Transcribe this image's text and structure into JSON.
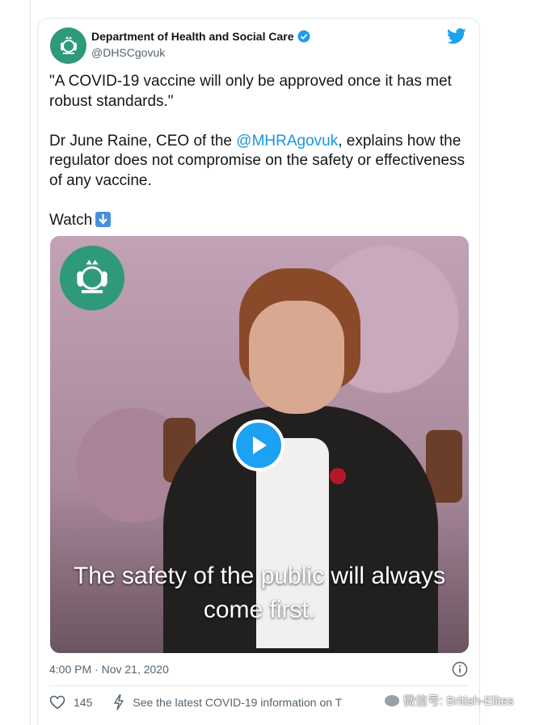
{
  "tweet": {
    "author_name": "Department of Health and Social Care",
    "handle": "@DHSCgovuk",
    "text_line1": "\"A COVID-19 vaccine will only be approved once it has met robust standards.\"",
    "text_part2_pre": "Dr June Raine, CEO of the ",
    "mention": "@MHRAgovuk",
    "text_part2_post": ", explains how the regulator does not compromise on the safety or effectiveness of any vaccine.",
    "watch_label": "Watch",
    "video_caption": "The safety of the public will always come first.",
    "timestamp": "4:00 PM · Nov 21, 2020",
    "likes": "145",
    "covid_info": "See the latest COVID-19 information on T"
  },
  "watermark": "微信号: British-Elites",
  "colors": {
    "brand_blue": "#1da1f2",
    "verified_blue": "#1d9bf0",
    "crest_green": "#2f9a7a",
    "muted": "#536471"
  }
}
